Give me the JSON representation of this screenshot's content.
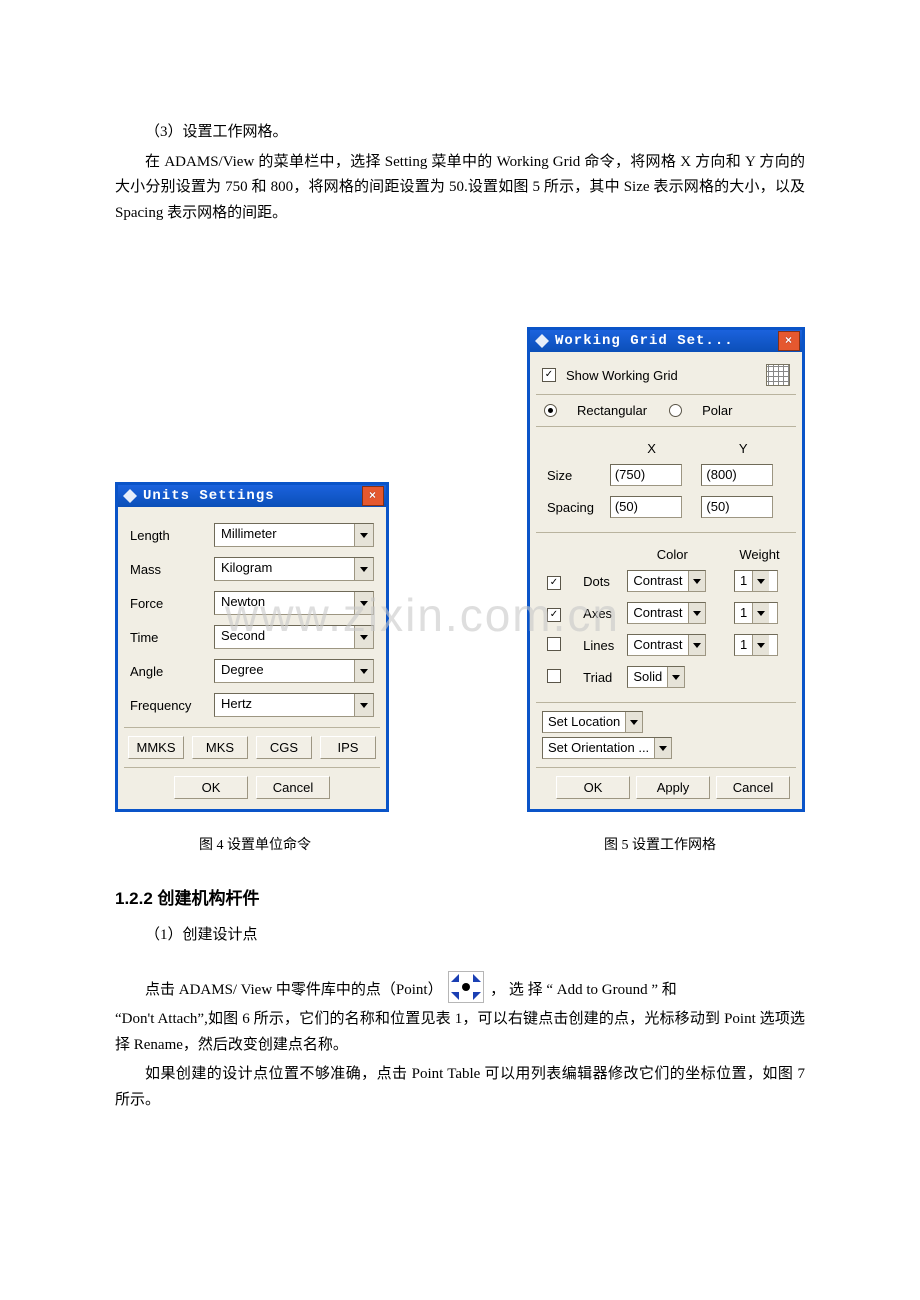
{
  "body": {
    "p1": "（3）设置工作网格。",
    "p2": "在 ADAMS/View 的菜单栏中，选择 Setting 菜单中的 Working Grid 命令，将网格 X 方向和 Y 方向的大小分别设置为 750 和 800，将网格的间距设置为 50.设置如图 5 所示，其中 Size 表示网格的大小，以及 Spacing 表示网格的间距。",
    "cap4": "图 4    设置单位命令",
    "cap5": "图 5    设置工作网格",
    "h122": "1.2.2  创建机构杆件",
    "p3": "（1）创建设计点",
    "p4a": "点击 ADAMS/ View 中零件库中的点（Point）",
    "p4b": "， 选 择 “ Add   to   Ground ” 和",
    "p5": "“Don't   Attach”,如图 6 所示，它们的名称和位置见表 1，可以右键点击创建的点，光标移动到 Point 选项选择 Rename，然后改变创建点名称。",
    "p6": "如果创建的设计点位置不够准确，点击 Point Table 可以用列表编辑器修改它们的坐标位置，如图 7 所示。"
  },
  "unitsDlg": {
    "title": "Units Settings",
    "rows": {
      "length": {
        "label": "Length",
        "value": "Millimeter"
      },
      "mass": {
        "label": "Mass",
        "value": "Kilogram"
      },
      "force": {
        "label": "Force",
        "value": "Newton"
      },
      "time": {
        "label": "Time",
        "value": "Second"
      },
      "angle": {
        "label": "Angle",
        "value": "Degree"
      },
      "frequency": {
        "label": "Frequency",
        "value": "Hertz"
      }
    },
    "presets": {
      "mmks": "MMKS",
      "mks": "MKS",
      "cgs": "CGS",
      "ips": "IPS"
    },
    "ok": "OK",
    "cancel": "Cancel"
  },
  "gridDlg": {
    "title": "Working Grid Set...",
    "showGrid": "Show Working Grid",
    "rect": "Rectangular",
    "polar": "Polar",
    "xh": "X",
    "yh": "Y",
    "sizeLabel": "Size",
    "sizeX": "(750)",
    "sizeY": "(800)",
    "spacingLabel": "Spacing",
    "spacingX": "(50)",
    "spacingY": "(50)",
    "colorH": "Color",
    "weightH": "Weight",
    "dots": "Dots",
    "axes": "Axes",
    "lines": "Lines",
    "triad": "Triad",
    "contrast": "Contrast",
    "solid": "Solid",
    "one": "1",
    "setLoc": "Set Location",
    "setOri": "Set Orientation ...",
    "ok": "OK",
    "apply": "Apply",
    "cancel": "Cancel"
  },
  "watermark": "www.zixin.com.cn"
}
